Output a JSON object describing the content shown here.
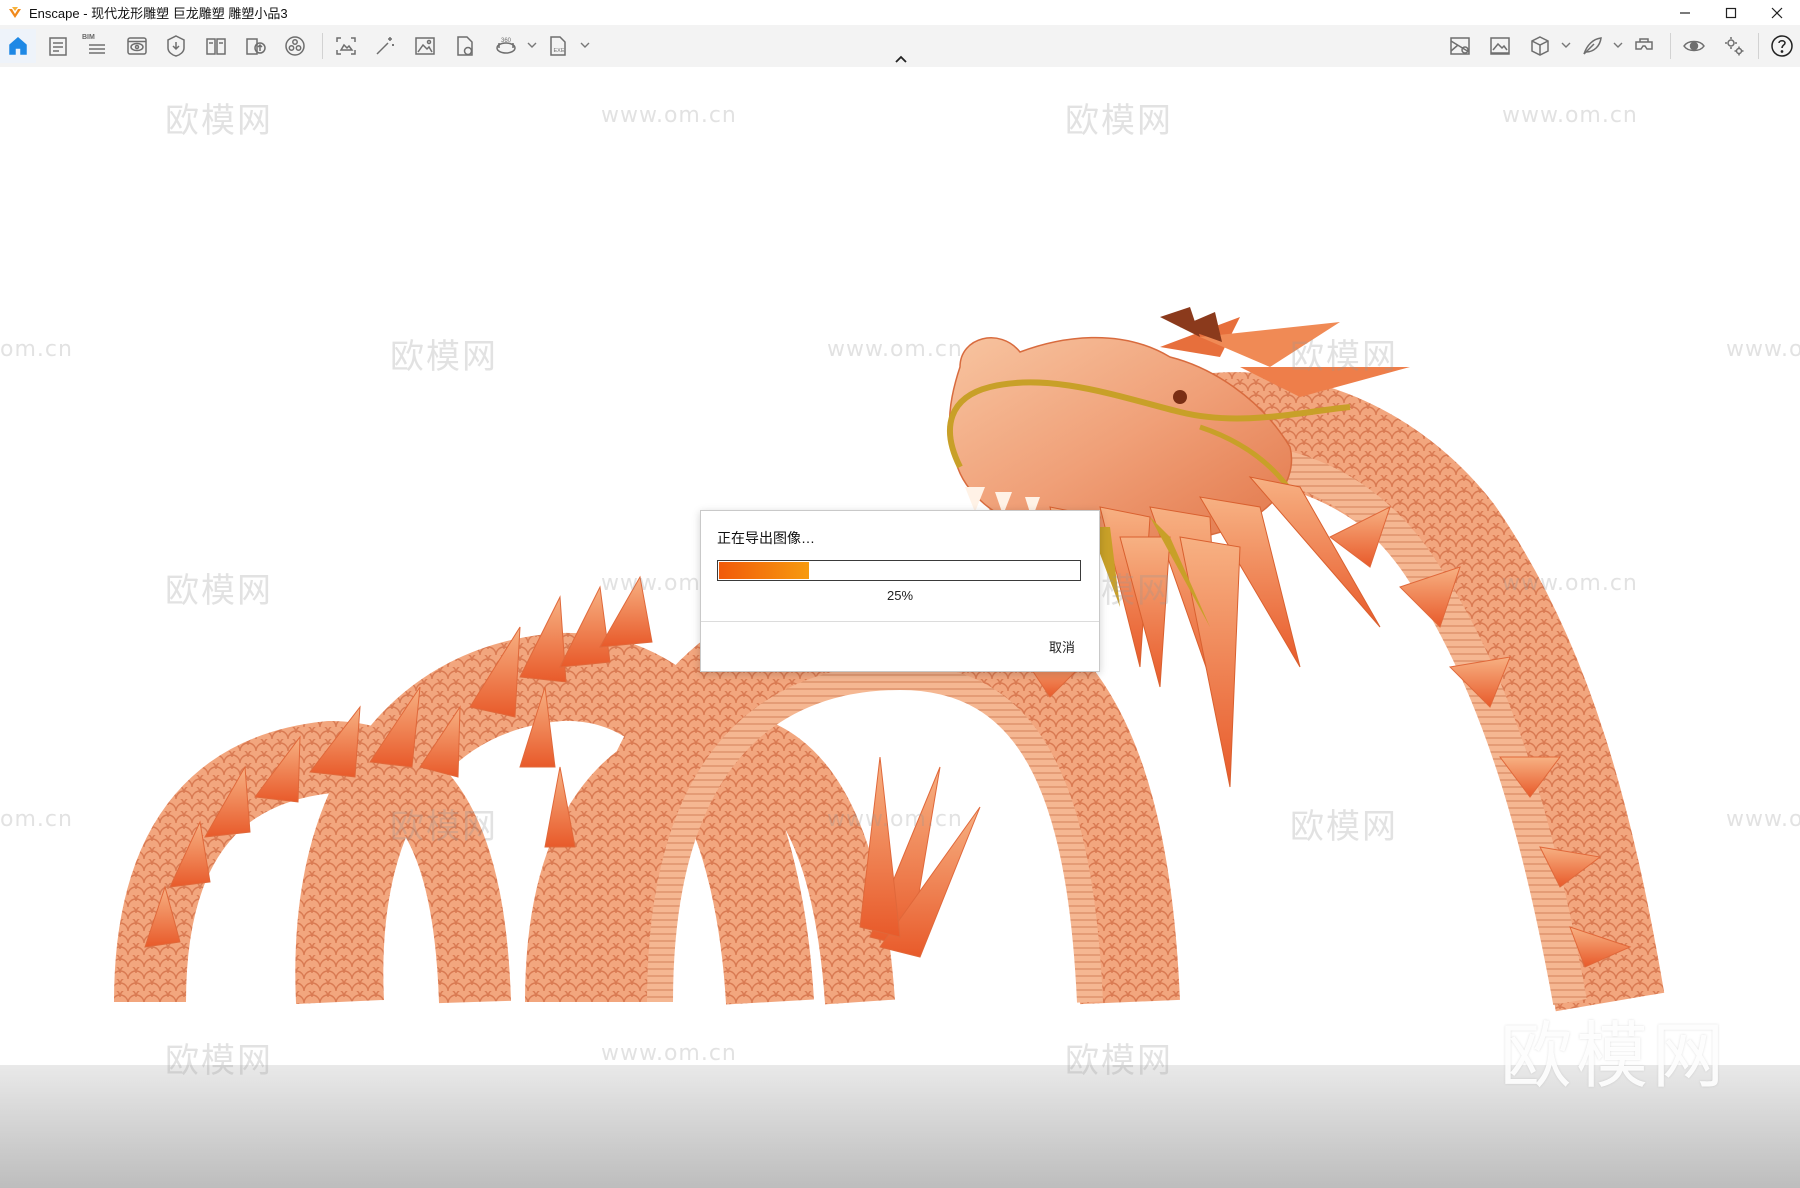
{
  "window": {
    "title": "Enscape - 现代龙形雕塑 巨龙雕塑 雕塑小品3",
    "controls": [
      "minimize",
      "maximize",
      "close"
    ]
  },
  "toolbar": {
    "bim_label": "BIM",
    "left_icons": [
      "home-icon",
      "document-icon",
      "bim-list-icon",
      "view-icon",
      "asset-icon",
      "book-icon",
      "upload-icon",
      "material-icon",
      "screenshot-icon",
      "magic-wand-icon",
      "image-icon",
      "file-export-icon",
      "panorama-360-icon",
      "exe-export-icon"
    ],
    "right_icons": [
      "map-view-icon",
      "image-settings-icon",
      "cube-view-icon",
      "feather-icon",
      "vr-headset-icon",
      "eye-icon",
      "settings-icon",
      "help-icon"
    ]
  },
  "viewport": {
    "watermark_brand": "欧模网",
    "watermark_url": "www.om.cn",
    "watermark_url_partial_left": "om.cn",
    "watermark_url_partial_right": "www.o"
  },
  "dialog": {
    "title": "正在导出图像…",
    "progress_fraction": 0.25,
    "progress_label": "25%",
    "cancel_label": "取消"
  },
  "colors": {
    "accent": "#1e88e5",
    "progress_start": "#f15a0a",
    "progress_end": "#f79a0e",
    "dragon_body": "#f0a078",
    "dragon_fin": "#f2894a",
    "dragon_gold": "#c8a028"
  }
}
